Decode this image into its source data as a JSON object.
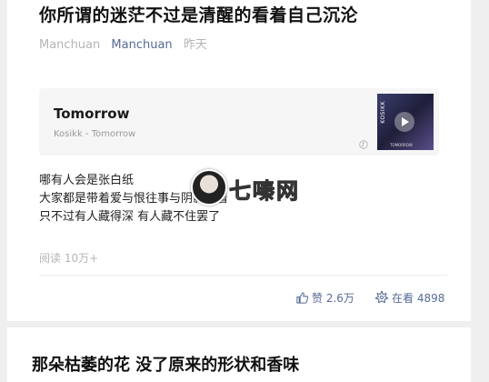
{
  "article": {
    "title": "你所谓的迷茫不过是清醒的看着自己沉沦",
    "source": "Manchuan",
    "author": "Manchuan",
    "time": "昨天"
  },
  "music": {
    "song": "Tomorrow",
    "artist": "Kosikk - Tomorrow",
    "cover_side_text": "KOSIKK",
    "cover_caption": "TOMORROW",
    "icons": [
      "music-note-icon",
      "play-icon"
    ]
  },
  "lyrics": [
    "哪有人会是张白纸",
    "大家都是带着爱与恨往事与阴影活着",
    "只不过有人藏得深 有人藏不住罢了"
  ],
  "watermark": {
    "text": "七嗪网"
  },
  "stats": {
    "reads": "阅读 10万+",
    "likes": "赞 2.6万",
    "watching": "在看 4898"
  },
  "next_article": {
    "title": "那朵枯萎的花 没了原来的形状和香味"
  },
  "colors": {
    "link": "#576b95",
    "muted": "#b4b4b4"
  }
}
